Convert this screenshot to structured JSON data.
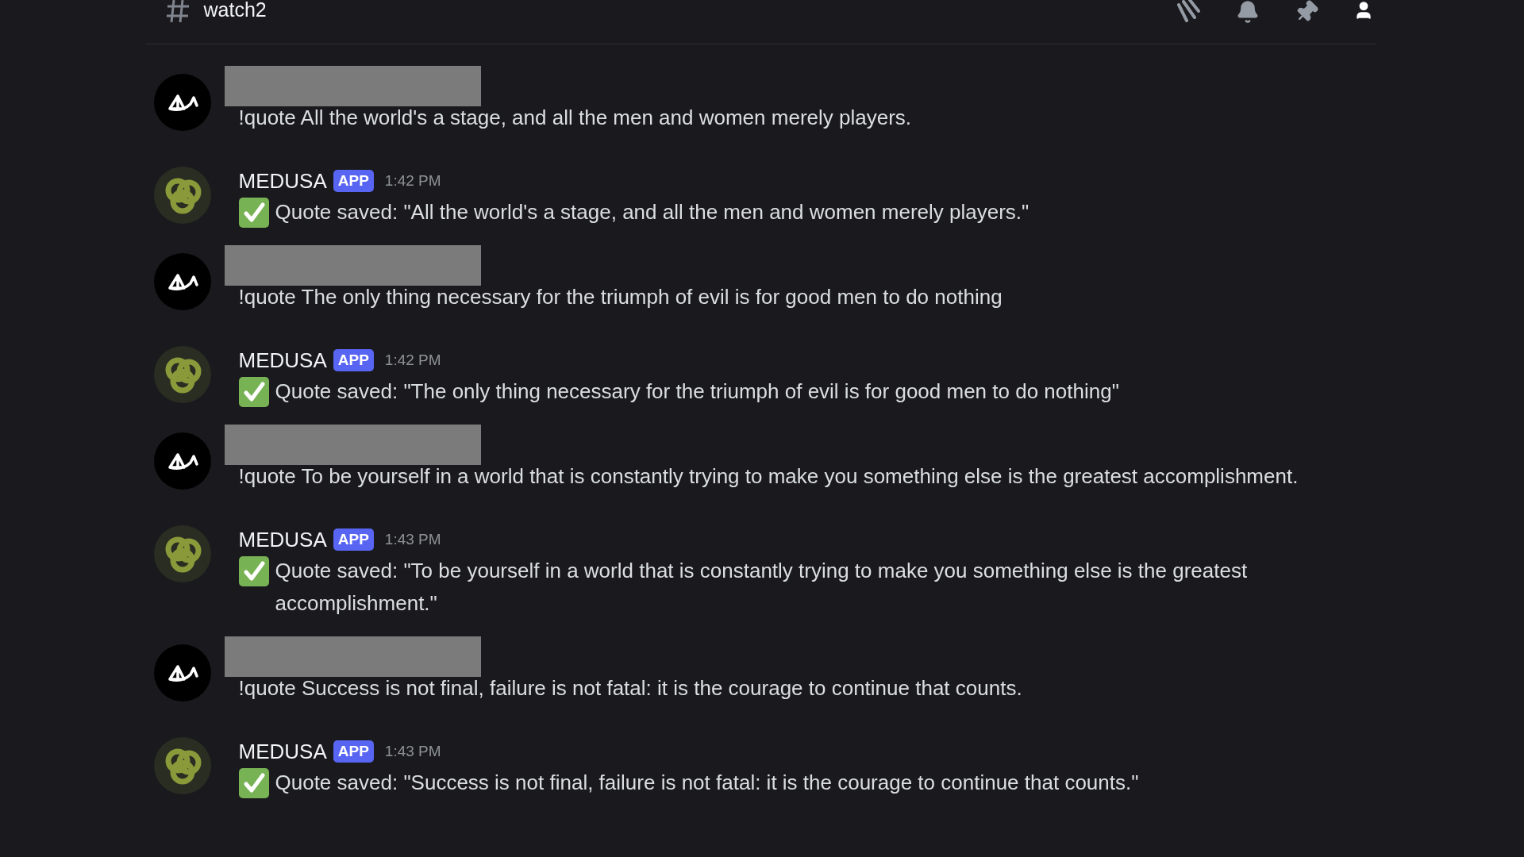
{
  "channel": {
    "name": "watch2"
  },
  "messages": [
    {
      "kind": "user",
      "text": "!quote All the world's a stage, and all the men and women merely players."
    },
    {
      "kind": "bot",
      "author": "MEDUSA",
      "badge": "APP",
      "time": "1:42 PM",
      "text": "Quote saved: \"All the world's a stage, and all the men and women merely players.\""
    },
    {
      "kind": "user",
      "text": "!quote The only thing necessary for the triumph of evil is for good men to do nothing"
    },
    {
      "kind": "bot",
      "author": "MEDUSA",
      "badge": "APP",
      "time": "1:42 PM",
      "text": "Quote saved: \"The only thing necessary for the triumph of evil is for good men to do nothing\""
    },
    {
      "kind": "user",
      "text": "!quote To be yourself in a world that is constantly trying to make you something else is the greatest accomplishment."
    },
    {
      "kind": "bot",
      "author": "MEDUSA",
      "badge": "APP",
      "time": "1:43 PM",
      "text": "Quote saved: \"To be yourself in a world that is constantly trying to make you something else is the greatest accomplishment.\""
    },
    {
      "kind": "user",
      "text": "!quote Success is not final, failure is not fatal: it is the courage to continue that counts."
    },
    {
      "kind": "bot",
      "author": "MEDUSA",
      "badge": "APP",
      "time": "1:43 PM",
      "text": "Quote saved: \"Success is not final, failure is not fatal: it is the courage to continue that counts.\""
    }
  ]
}
